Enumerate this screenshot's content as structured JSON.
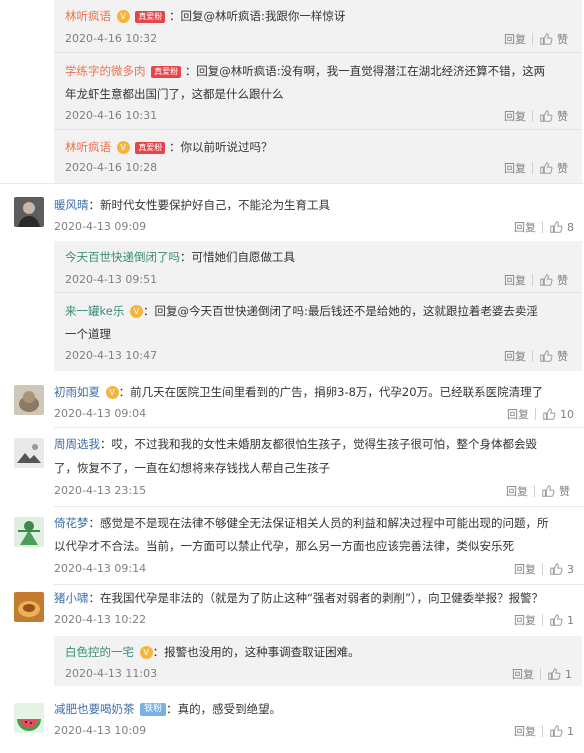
{
  "top_replies": [
    {
      "user": "林听疯语",
      "badge": "真爱粉",
      "text": "：回复@林听疯语:我跟你一样惊讶",
      "time": "2020-4-16 10:32",
      "reply": "回复",
      "like": "赞"
    },
    {
      "user": "学练字的微多肉",
      "badge": "真爱粉",
      "text1": "：回复@林听疯语:没有啊，我一直觉得潜江在湖北经济还算不错，这两",
      "text2": "年龙虾生意都出国门了，这都是什么跟什么",
      "time": "2020-4-16 10:31",
      "reply": "回复",
      "like": "赞"
    },
    {
      "user": "林听疯语",
      "badge": "真爱粉",
      "text": "：你以前听说过吗？",
      "time": "2020-4-16 10:28",
      "reply": "回复",
      "like": "赞"
    }
  ],
  "comments": [
    {
      "user": "暖风晴",
      "text": "：新时代女性要保护好自己，不能沦为生育工具",
      "time": "2020-4-13 09:09",
      "reply": "回复",
      "likes": "8"
    },
    {
      "user": "初雨如夏",
      "text": "：前几天在医院卫生间里看到的广告，捐卵3-8万，代孕20万。已经联系医院清理了",
      "time": "2020-4-13 09:04",
      "reply": "回复",
      "likes": "10"
    },
    {
      "user": "周周选我",
      "text1": "：哎，不过我和我的女性未婚朋友都很怕生孩子，觉得生孩子很可怕，整个身体都会毁",
      "text2": "了，恢复不了，一直在幻想将来存钱找人帮自己生孩子",
      "time": "2020-4-13 23:15",
      "reply": "回复",
      "like": "赞"
    },
    {
      "user": "倚花梦",
      "text1": "：感觉是不是现在法律不够健全无法保证相关人员的利益和解决过程中可能出现的问题，所",
      "text2": "以代孕才不合法。当前，一方面可以禁止代孕，那么另一方面也应该完善法律，类似安乐死",
      "time": "2020-4-13 09:14",
      "reply": "回复",
      "likes": "3"
    },
    {
      "user": "猪小啸",
      "text": "：在我国代孕是非法的（就是为了防止这种“强者对弱者的剥削”），向卫健委举报？报警？",
      "time": "2020-4-13 10:22",
      "reply": "回复",
      "likes": "1"
    },
    {
      "user": "减肥也要喝奶茶",
      "badge": "铁粉",
      "text": "：真的，感受到绝望。",
      "time": "2020-4-13 10:09",
      "reply": "回复",
      "likes": "1"
    }
  ],
  "sub_replies_1": [
    {
      "user": "今天百世快递倒闭了吗",
      "text": "：可惜她们自愿做工具",
      "time": "2020-4-13 09:51",
      "reply": "回复",
      "like": "赞"
    },
    {
      "user": "来一罐ke乐",
      "text1": "：回复@今天百世快递倒闭了吗:最后钱还不是给她的，这就跟拉着老婆去卖淫",
      "text2": "一个道理",
      "mention": "@今天百世快递倒闭了吗",
      "time": "2020-4-13 10:47",
      "reply": "回复",
      "like": "赞"
    }
  ],
  "sub_replies_2": [
    {
      "user": "白色控的一宅",
      "text": "：报警也没用的，这种事调查取证困难。",
      "time": "2020-4-13 11:03",
      "reply": "回复",
      "likes": "1"
    }
  ],
  "colors": {
    "username": "#eb7350",
    "link": "#3f6ea7",
    "box": "#f2f2f2",
    "meta": "#808080"
  }
}
